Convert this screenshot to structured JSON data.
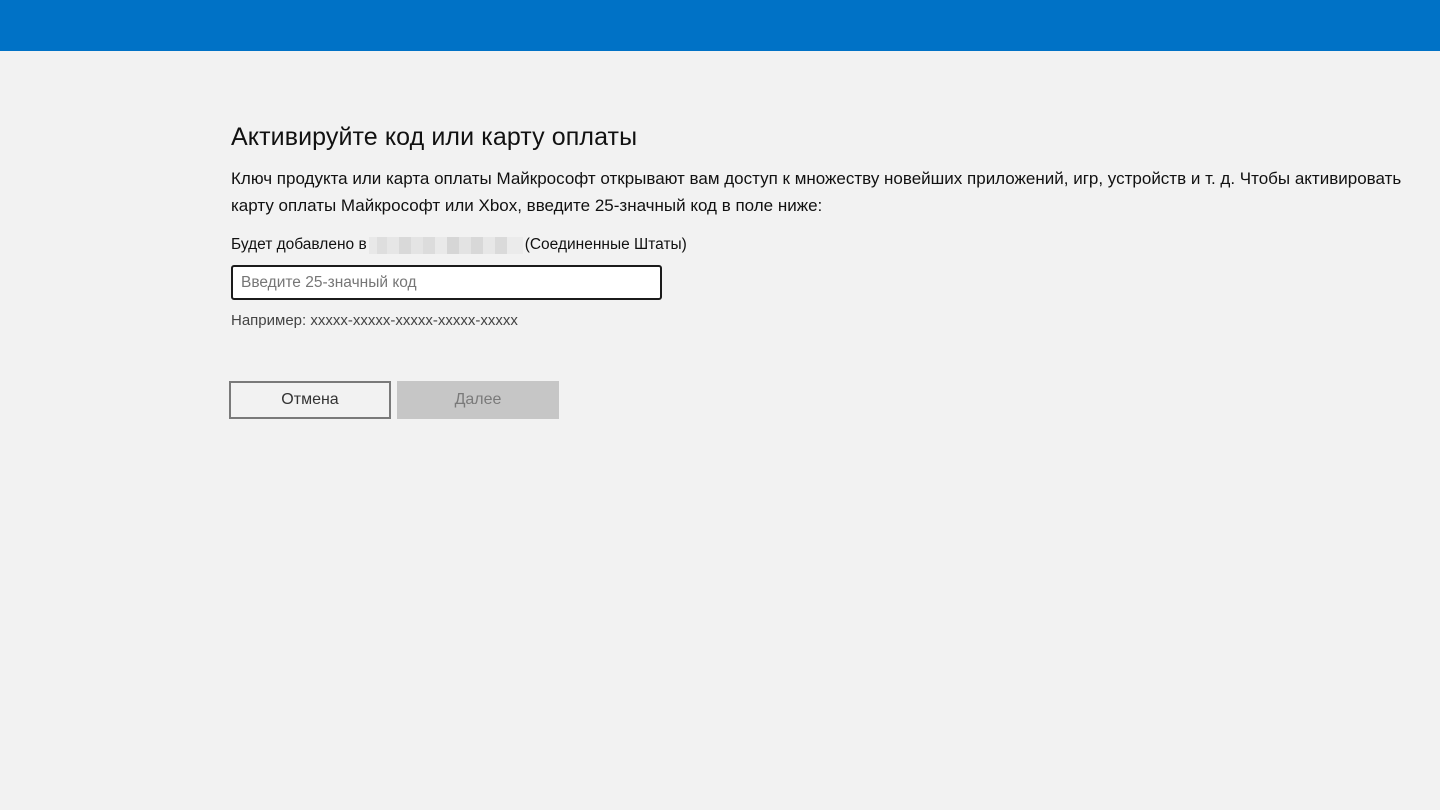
{
  "header": {
    "bar_color": "#0072c6"
  },
  "main": {
    "title": "Активируйте код или карту оплаты",
    "description": "Ключ продукта или карта оплаты Майкрософт открывают вам доступ к множеству новейших приложений, игр, устройств и т. д. Чтобы активировать карту оплаты Майкрософт или Xbox, введите 25-значный код в поле ниже:",
    "account_prefix": "Будет добавлено в",
    "account_region": "(Соединенные Штаты)",
    "code_input": {
      "value": "",
      "placeholder": "Введите 25-значный код"
    },
    "example": "Например: xxxxx-xxxxx-xxxxx-xxxxx-xxxxx"
  },
  "actions": {
    "cancel_label": "Отмена",
    "next_label": "Далее",
    "next_disabled": true
  }
}
